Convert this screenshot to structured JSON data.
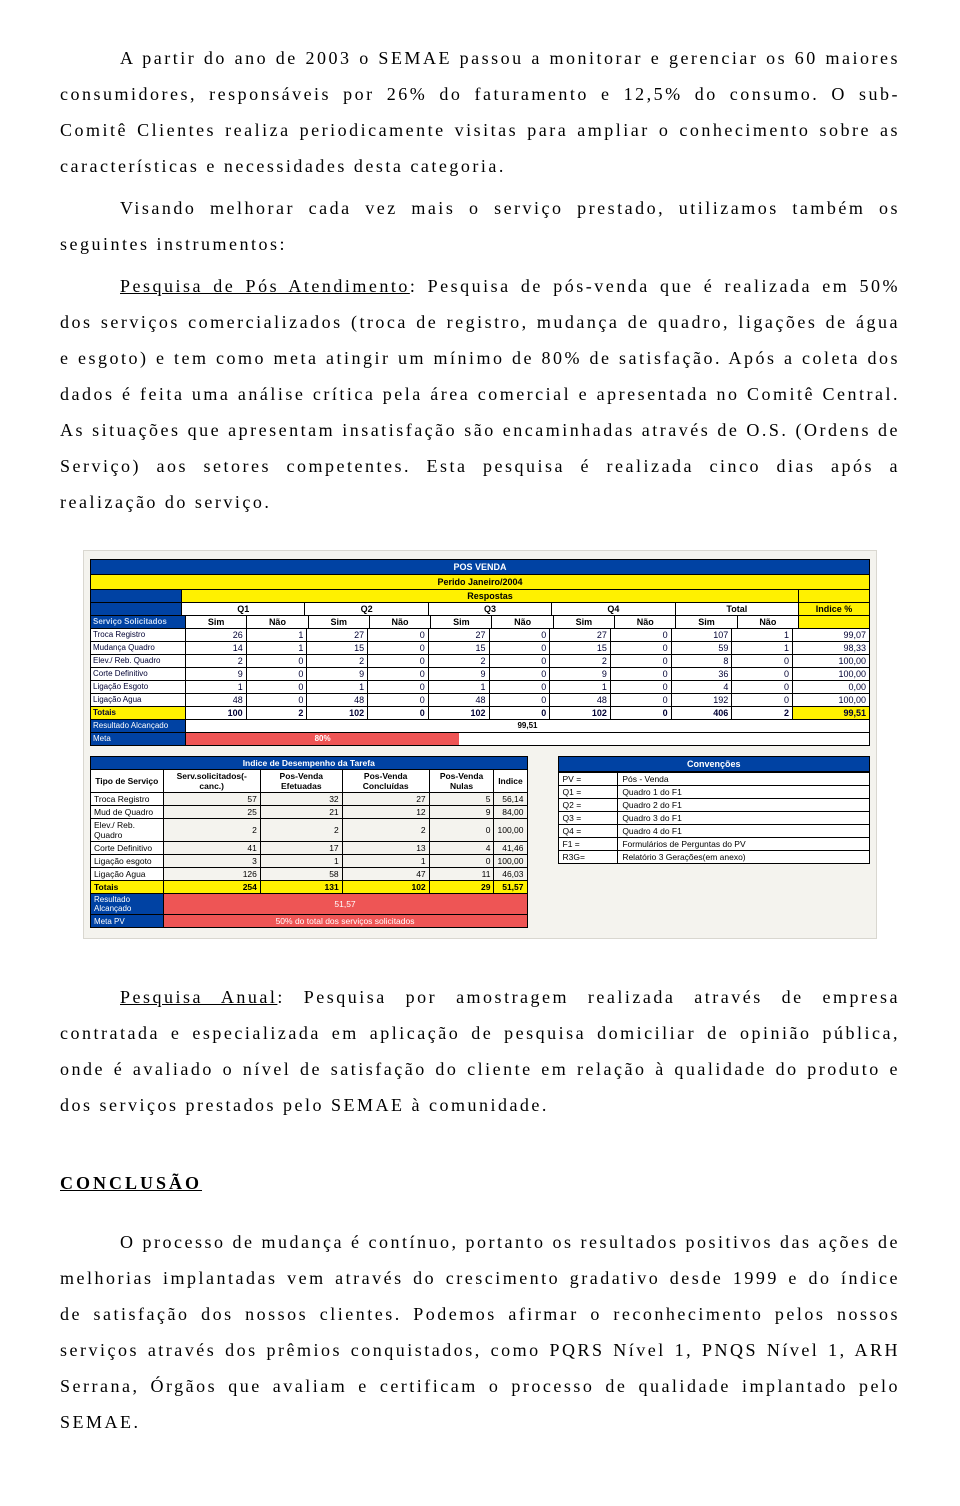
{
  "para1_a": "A partir do ano de 2003 o SEMAE passou a monitorar e gerenciar os 60 maiores consumidores, responsáveis por 26% do faturamento e 12,5% do consumo. O sub-Comitê Clientes realiza periodicamente visitas para ampliar o conhecimento sobre as características e necessidades desta categoria.",
  "para1_b": "Visando melhorar cada vez mais o serviço prestado, utilizamos também os seguintes instrumentos:",
  "para1_c_label": "Pesquisa de Pós Atendimento",
  "para1_c_rest": ": Pesquisa de pós-venda que é realizada em 50% dos serviços comercializados (troca de registro, mudança de quadro, ligações de água e esgoto) e tem como meta atingir um mínimo de 80% de satisfação. Após a coleta dos dados é feita uma análise crítica pela área comercial e apresentada no Comitê Central. As situações que apresentam insatisfação são encaminhadas através de O.S. (Ordens de Serviço) aos setores competentes. Esta pesquisa é realizada cinco dias após a realização do serviço.",
  "para2_label": "Pesquisa Anual",
  "para2_rest": ": Pesquisa por amostragem realizada através de empresa contratada e especializada em aplicação de pesquisa domiciliar de opinião pública, onde é avaliado o nível de satisfação do cliente em relação à qualidade do produto e dos serviços prestados pelo SEMAE à comunidade.",
  "conclusion_heading": "CONCLUSÃO",
  "conclusion_para": "O processo de mudança é contínuo, portanto os resultados positivos das ações de melhorias implantadas vem através do crescimento gradativo desde 1999 e do índice de satisfação dos nossos clientes. Podemos afirmar o reconhecimento pelos nossos serviços através dos prêmios conquistados, como PQRS Nível 1, PNQS Nível 1, ARH Serrana, Órgãos que avaliam e certificam o processo de qualidade implantado pelo SEMAE.",
  "chart_data": {
    "pos_venda": {
      "title": "POS VENDA",
      "subtitle": "Perido Janeiro/2004",
      "respostas_label": "Respostas",
      "servico_label": "Serviço Solicitados",
      "quarters": [
        "Q1",
        "Q2",
        "Q3",
        "Q4"
      ],
      "total_label": "Total",
      "indice_label": "Indice %",
      "sim": "Sim",
      "nao": "Não",
      "rows": [
        {
          "name": "Troca Registro",
          "q1s": 26,
          "q1n": 1,
          "q2s": 27,
          "q2n": 0,
          "q3s": 27,
          "q3n": 0,
          "q4s": 27,
          "q4n": 0,
          "ts": 107,
          "tn": 1,
          "ind": "99,07"
        },
        {
          "name": "Mudança Quadro",
          "q1s": 14,
          "q1n": 1,
          "q2s": 15,
          "q2n": 0,
          "q3s": 15,
          "q3n": 0,
          "q4s": 15,
          "q4n": 0,
          "ts": 59,
          "tn": 1,
          "ind": "98,33"
        },
        {
          "name": "Elev./ Reb. Quadro",
          "q1s": 2,
          "q1n": 0,
          "q2s": 2,
          "q2n": 0,
          "q3s": 2,
          "q3n": 0,
          "q4s": 2,
          "q4n": 0,
          "ts": 8,
          "tn": 0,
          "ind": "100,00"
        },
        {
          "name": "Corte Definitivo",
          "q1s": 9,
          "q1n": 0,
          "q2s": 9,
          "q2n": 0,
          "q3s": 9,
          "q3n": 0,
          "q4s": 9,
          "q4n": 0,
          "ts": 36,
          "tn": 0,
          "ind": "100,00"
        },
        {
          "name": "Ligação Esgoto",
          "q1s": 1,
          "q1n": 0,
          "q2s": 1,
          "q2n": 0,
          "q3s": 1,
          "q3n": 0,
          "q4s": 1,
          "q4n": 0,
          "ts": 4,
          "tn": 0,
          "ind": "0,00"
        },
        {
          "name": "Ligação Agua",
          "q1s": 48,
          "q1n": 0,
          "q2s": 48,
          "q2n": 0,
          "q3s": 48,
          "q3n": 0,
          "q4s": 48,
          "q4n": 0,
          "ts": 192,
          "tn": 0,
          "ind": "100,00"
        }
      ],
      "totais": {
        "name": "Totais",
        "q1s": 100,
        "q1n": 2,
        "q2s": 102,
        "q2n": 0,
        "q3s": 102,
        "q3n": 0,
        "q4s": 102,
        "q4n": 0,
        "ts": 406,
        "tn": 2,
        "ind": "99,51"
      },
      "resultado_label": "Resultado Alcançado",
      "resultado_val": "99,51",
      "meta_label": "Meta",
      "meta_val": "80%"
    },
    "tarefa": {
      "title": "Indice de Desempenho da Tarefa",
      "headers": [
        "Tipo de Serviço",
        "Serv.solicitados(- canc.)",
        "Pos-Venda Efetuadas",
        "Pos-Venda Concluídas",
        "Pos-Venda Nulas",
        "Indice"
      ],
      "rows": [
        {
          "n": "Troca Registro",
          "a": 57,
          "b": 32,
          "c": 27,
          "d": 5,
          "i": "56,14"
        },
        {
          "n": "Mud de Quadro",
          "a": 25,
          "b": 21,
          "c": 12,
          "d": 9,
          "i": "84,00"
        },
        {
          "n": "Elev./ Reb. Quadro",
          "a": 2,
          "b": 2,
          "c": 2,
          "d": 0,
          "i": "100,00"
        },
        {
          "n": "Corte Definitivo",
          "a": 41,
          "b": 17,
          "c": 13,
          "d": 4,
          "i": "41,46"
        },
        {
          "n": "Ligação esgoto",
          "a": 3,
          "b": 1,
          "c": 1,
          "d": 0,
          "i": "100,00"
        },
        {
          "n": "Ligação Agua",
          "a": 126,
          "b": 58,
          "c": 47,
          "d": 11,
          "i": "46,03"
        }
      ],
      "totais": {
        "n": "Totais",
        "a": 254,
        "b": 131,
        "c": 102,
        "d": 29,
        "i": "51,57"
      },
      "resultado_label": "Resultado Alcançado",
      "resultado_val": "51,57",
      "meta_label": "Meta PV",
      "meta_val": "50% do total dos serviços solicitados"
    },
    "convencoes": {
      "title": "Convenções",
      "rows": [
        [
          "PV =",
          "Pós - Venda"
        ],
        [
          "Q1 =",
          "Quadro 1 do F1"
        ],
        [
          "Q2 =",
          "Quadro 2 do F1"
        ],
        [
          "Q3 =",
          "Quadro 3 do F1"
        ],
        [
          "Q4 =",
          "Quadro 4 do F1"
        ],
        [
          "F1 =",
          "Formulários de Perguntas do PV"
        ],
        [
          "R3G=",
          "Relatório 3 Gerações(em anexo)"
        ]
      ]
    }
  }
}
